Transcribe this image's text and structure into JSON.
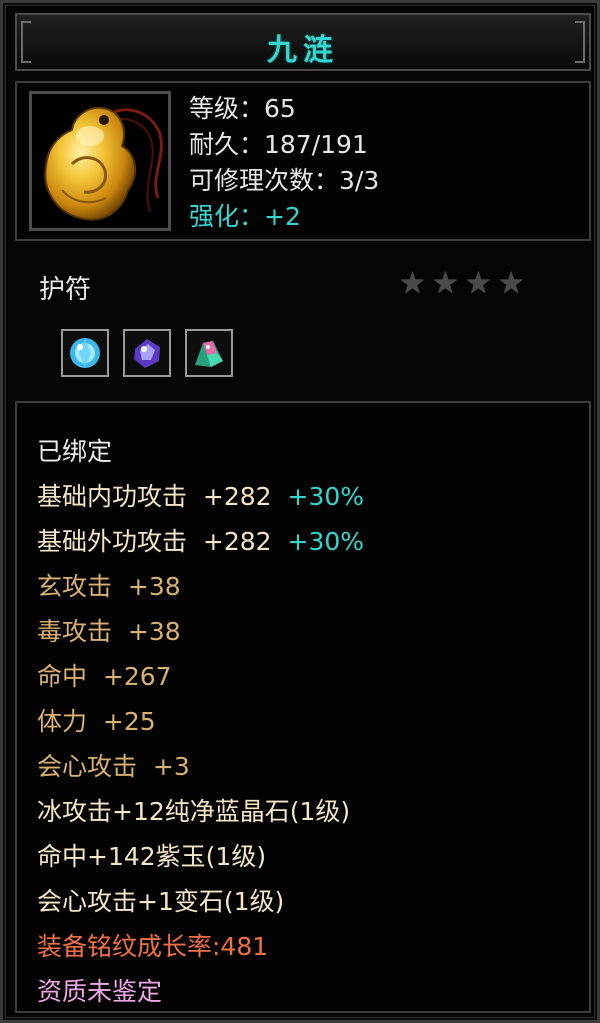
{
  "title": "九涟",
  "item": {
    "icon": "golden-jade-pendant-icon",
    "level": "等级：65",
    "durability": "耐久：187/191",
    "repair_count": "可修理次数：3/3",
    "enhance": "强化：+2",
    "name": "护符",
    "stars_total": 4,
    "gems": [
      "blue-crystal-gem-icon",
      "purple-jade-gem-icon",
      "variant-stone-gem-icon"
    ]
  },
  "attributes": {
    "bound": "已绑定",
    "rows": [
      {
        "name": "基础内功攻击",
        "value": "+282",
        "bonus": "+30%"
      },
      {
        "name": "基础外功攻击",
        "value": "+282",
        "bonus": "+30%"
      },
      {
        "name": "玄攻击",
        "value": "+38"
      },
      {
        "name": "毒攻击",
        "value": "+38"
      },
      {
        "name": "命中",
        "value": "+267"
      },
      {
        "name": "体力",
        "value": "+25"
      },
      {
        "name": "会心攻击",
        "value": "+3"
      }
    ],
    "gem_lines": [
      "冰攻击+12纯净蓝晶石(1级)",
      "命中+142紫玉(1级)",
      "会心攻击+1变石(1级)"
    ],
    "growth": "装备铭纹成长率:481",
    "quality": "资质未鉴定"
  },
  "colors": {
    "title": "#36d6d0",
    "bonus": "#36d6d0",
    "attribute": "#d8b072",
    "growth": "#f07045",
    "quality": "#f0a7e8"
  }
}
